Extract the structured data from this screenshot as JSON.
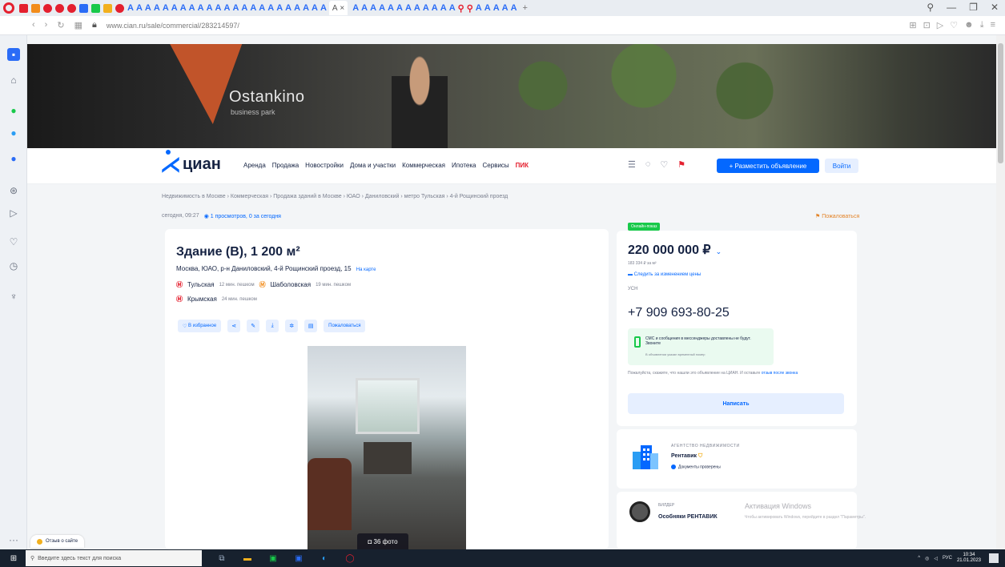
{
  "browser": {
    "url": "www.cian.ru/sale/commercial/283214597/",
    "active_tab_label": "А",
    "tab_letter": "А"
  },
  "hero": {
    "brand": "Ostankino",
    "subtitle": "business park"
  },
  "header": {
    "logo_text": "циан",
    "menu": [
      "Аренда",
      "Продажа",
      "Новостройки",
      "Дома и участки",
      "Коммерческая",
      "Ипотека",
      "Сервисы",
      "ПИК"
    ],
    "post_button": "+ Разместить объявление",
    "login_button": "Войти"
  },
  "breadcrumb": "Недвижимость в Москве › Коммерческая › Продажа зданий в Москве › ЮАО › Даниловский › метро Тульская › 4-й Рощинский проезд",
  "meta": {
    "date": "сегодня, 09:27",
    "views": "1 просмотров, 0 за сегодня",
    "complain": "Пожаловаться"
  },
  "listing": {
    "title": "Здание (B), 1 200 м²",
    "address": "Москва, ЮАО, р-н Даниловский, 4-й Рощинский проезд, 15",
    "map_link": "На карте",
    "metro": [
      {
        "name": "Тульская",
        "time": "12 мин. пешком",
        "color": "#e4202f"
      },
      {
        "name": "Шаболовская",
        "time": "19 мин. пешком",
        "color": "#f28c1b"
      },
      {
        "name": "Крымская",
        "time": "24 мин. пешком",
        "color": "#e4202f"
      }
    ],
    "favorite_button": "В избранное",
    "complain_button": "Пожаловаться",
    "photo_count": "36 фото"
  },
  "price_card": {
    "badge": "Онлайн-показ",
    "price": "220 000 000 ₽",
    "per_m": "183 334 ₽ за м²",
    "follow": "Следить за изменением цены",
    "tax": "УСН",
    "phone": "+7 909 693-80-25",
    "sms_line1": "СМС и сообщения в мессенджеры доставлены не будут. Звоните",
    "sms_line2": "В объявлении указан временный номер",
    "notice": "Пожалуйста, скажите, что нашли это объявление на ЦИАН. И оставьте",
    "notice_link": "отзыв после звонка",
    "write_button": "Написать"
  },
  "agency": {
    "type": "АГЕНТСТВО НЕДВИЖИМОСТИ",
    "name": "Рентавик",
    "docs": "Документы проверены"
  },
  "builder": {
    "type": "БИЛДЕР",
    "name": "Особняки РЕНТАВИК"
  },
  "activation": {
    "line1": "Активация Windows",
    "line2": "Чтобы активировать Windows, перейдите в раздел \"Параметры\"."
  },
  "feedback": "Отзыв о сайте",
  "taskbar": {
    "search_placeholder": "Введите здесь текст для поиска",
    "lang": "РУС",
    "time": "10:34",
    "date": "21.01.2023"
  }
}
